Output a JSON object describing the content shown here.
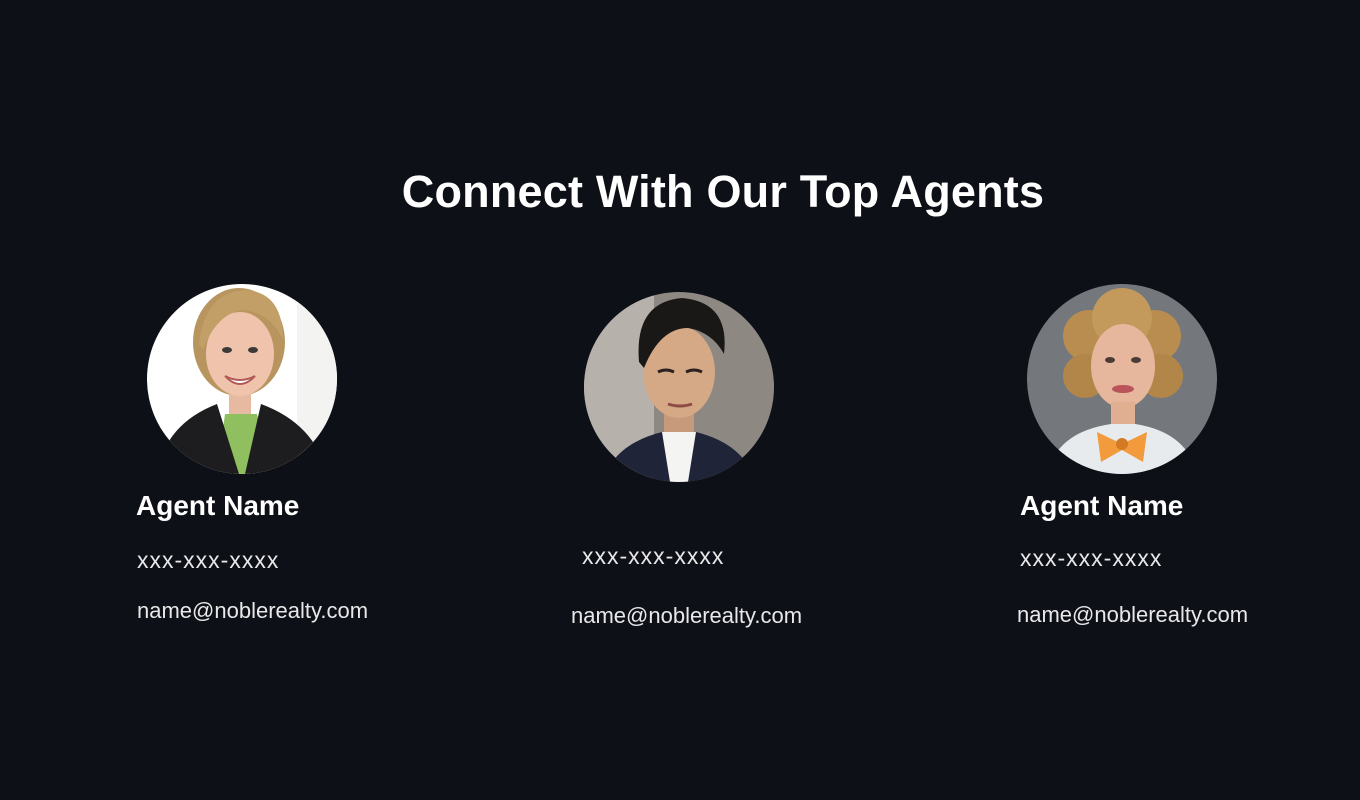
{
  "section": {
    "title": "Connect With Our Top Agents"
  },
  "agents": [
    {
      "name": "Agent Name",
      "phone": "xxx-xxx-xxxx",
      "email": "name@noblerealty.com"
    },
    {
      "name": "",
      "phone": "xxx-xxx-xxxx",
      "email": "name@noblerealty.com"
    },
    {
      "name": "Agent Name",
      "phone": "xxx-xxx-xxxx",
      "email": "name@noblerealty.com"
    }
  ],
  "colors": {
    "background": "#0d1016",
    "text": "#ffffff"
  }
}
